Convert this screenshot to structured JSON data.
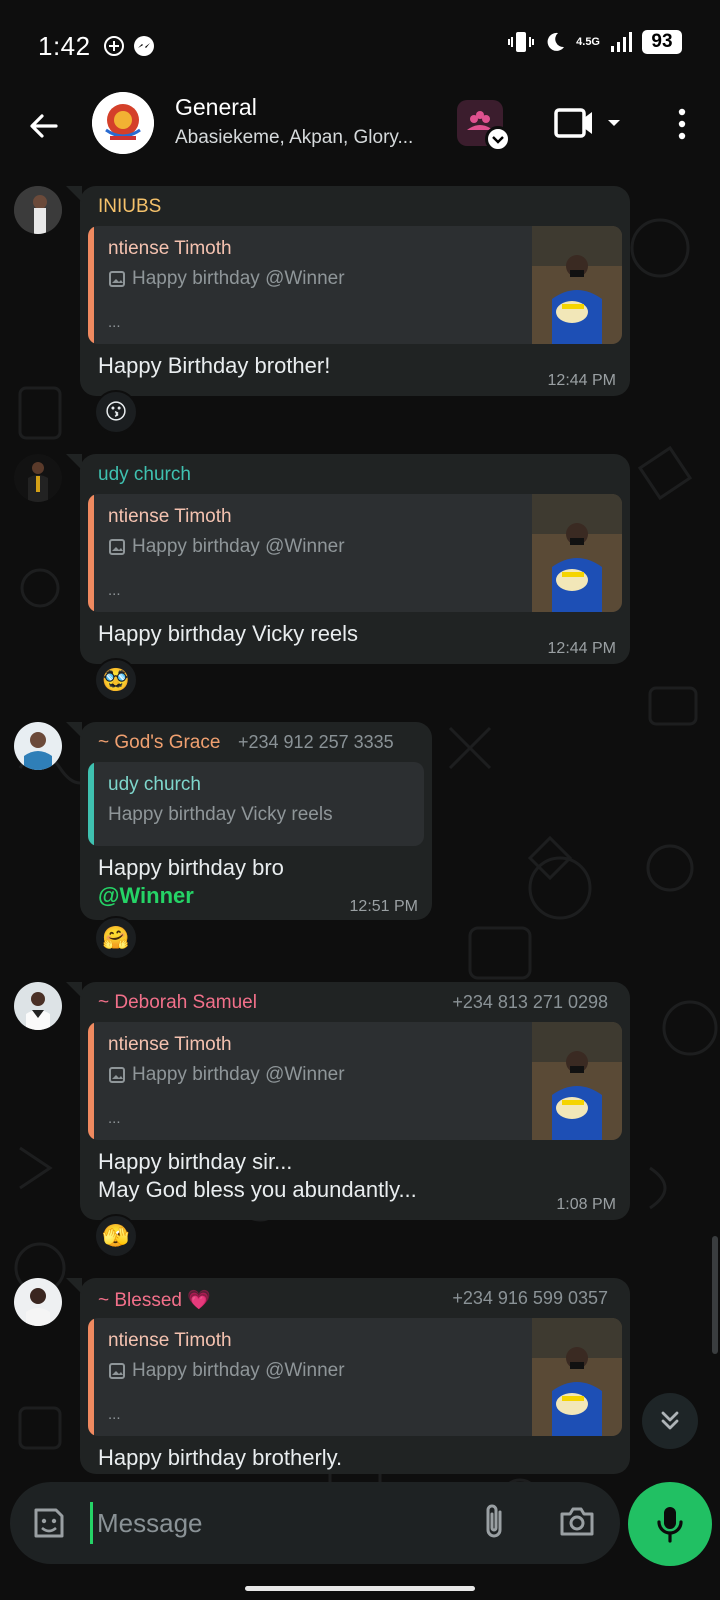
{
  "status_bar": {
    "time": "1:42",
    "network": "4.5G",
    "battery": "93"
  },
  "header": {
    "title": "General",
    "subtitle": "Abasiekeme, Akpan, Glory..."
  },
  "messages": [
    {
      "sender": "INIUBS",
      "sender_color": "#f5c26b",
      "phone": "",
      "quote_name": "ntiense Timoth",
      "quote_text": "Happy birthday @Winner",
      "quote_more": "...",
      "body": "Happy Birthday brother!",
      "time": "12:44 PM",
      "reaction": "😗"
    },
    {
      "sender": "udy church",
      "sender_color": "#53bdeb",
      "phone": "",
      "quote_name": "ntiense Timoth",
      "quote_text": "Happy birthday @Winner",
      "quote_more": "...",
      "body": "Happy birthday Vicky reels",
      "time": "12:44 PM",
      "reaction": "🥸"
    },
    {
      "sender": "~ God's Grace",
      "sender_color": "#f0a070",
      "phone": "+234 912 257 3335",
      "quote_name": "udy church",
      "quote_text": "Happy birthday Vicky reels",
      "body": "Happy birthday bro",
      "mention": "@Winner",
      "time": "12:51 PM",
      "reaction": "🤗"
    },
    {
      "sender": "~ Deborah Samuel",
      "sender_color": "#f2708a",
      "phone": "+234 813 271 0298",
      "quote_name": "ntiense Timoth",
      "quote_text": "Happy birthday @Winner",
      "quote_more": "...",
      "body_line1": "Happy birthday sir...",
      "body_line2": "May God bless you abundantly...",
      "time": "1:08 PM",
      "reaction": "🫣"
    },
    {
      "sender": "~ Blessed 💗",
      "sender_color": "#f2708a",
      "phone": "+234 916 599 0357",
      "quote_name": "ntiense Timoth",
      "quote_text": "Happy birthday @Winner",
      "quote_more": "...",
      "body": "Happy birthday brotherly."
    }
  ],
  "composer": {
    "placeholder": "Message"
  },
  "colors": {
    "accent": "#21c063",
    "quote_bar_orange": "#f08a60",
    "quote_bar_teal": "#3fc1b0"
  }
}
